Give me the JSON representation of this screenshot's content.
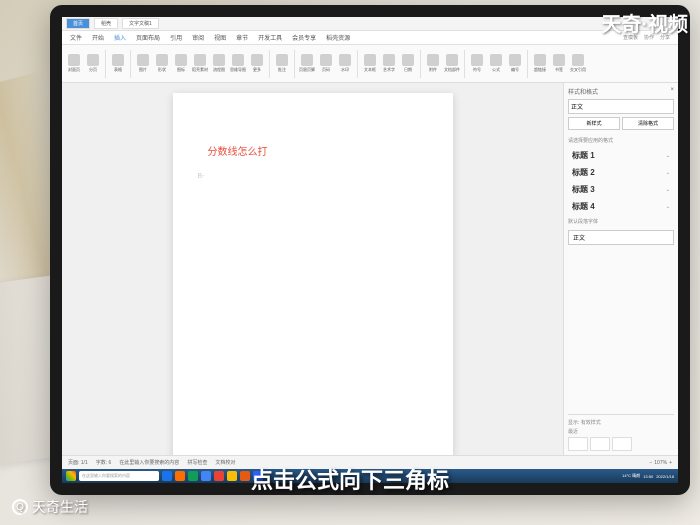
{
  "watermarks": {
    "top_right": "天奇·视频",
    "bottom_left": "天奇生活"
  },
  "subtitle": "点击公式向下三角标",
  "titlebar": {
    "tabs": [
      {
        "label": "首页",
        "active": true
      },
      {
        "label": "稻壳"
      },
      {
        "label": "文字文稿1"
      }
    ]
  },
  "menubar": {
    "items": [
      "文件",
      "开始",
      "插入",
      "页面布局",
      "引用",
      "审阅",
      "视图",
      "章节",
      "开发工具",
      "会员专享",
      "稻壳资源"
    ],
    "active_index": 2,
    "right": [
      "查模板",
      "协作",
      "分享"
    ]
  },
  "ribbon": {
    "groups": [
      [
        "封面页",
        "分页"
      ],
      [
        "表格"
      ],
      [
        "图片",
        "形状",
        "图标",
        "稻壳素材",
        "流程图",
        "思维导图",
        "更多"
      ],
      [
        "批注"
      ],
      [
        "页眉页脚",
        "页码",
        "水印"
      ],
      [
        "文本框",
        "艺术字",
        "日期"
      ],
      [
        "附件",
        "文档部件"
      ],
      [
        "符号",
        "公式",
        "编号"
      ],
      [
        "超链接",
        "书签",
        "交叉引用"
      ]
    ]
  },
  "document": {
    "text": "分数线怎么打",
    "cursor_mark": "B-"
  },
  "side_panel": {
    "title": "样式和格式",
    "current": "正文",
    "new_style_btn": "新样式",
    "clear_btn": "清除格式",
    "section_label": "请选择要应用的格式",
    "styles": [
      "标题 1",
      "标题 2",
      "标题 3",
      "标题 4"
    ],
    "list_label": "默认段落字体",
    "body_style": "正文",
    "show_label": "显示: 有效样式",
    "recent_label": "最近"
  },
  "statusbar": {
    "page": "页面: 1/1",
    "words": "字数: 6",
    "input_hint": "在此里输入你要搜索的内容",
    "spell": "拼写检查",
    "doc_check": "文档校对",
    "zoom": "107%"
  },
  "taskbar": {
    "search_placeholder": "在这里输入你要搜索的内容",
    "weather": "14°C 晴朗",
    "time": "13:50",
    "date": "2022/1/18"
  }
}
